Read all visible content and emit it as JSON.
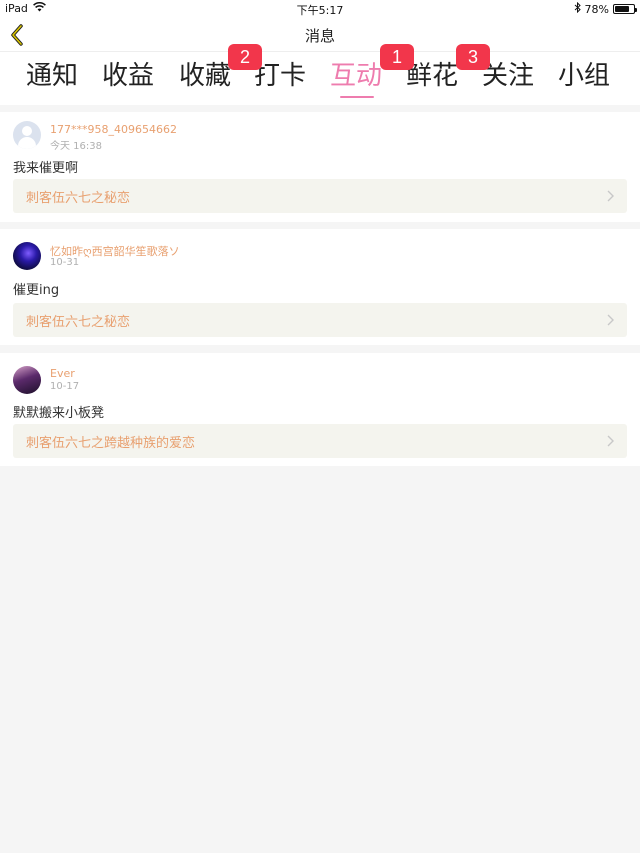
{
  "status_bar": {
    "device": "iPad",
    "time": "下午5:17",
    "battery": "78%",
    "battery_level": 0.78
  },
  "nav": {
    "title": "消息",
    "back_icon": "chevron-left-icon",
    "back_color": "#c9b800"
  },
  "tabs": [
    {
      "label": "通知"
    },
    {
      "label": "收益"
    },
    {
      "label": "收藏",
      "badge": "2"
    },
    {
      "label": "打卡"
    },
    {
      "label": "互动",
      "active": true,
      "badge": "1"
    },
    {
      "label": "鲜花",
      "badge": "3"
    },
    {
      "label": "关注"
    },
    {
      "label": "小组"
    }
  ],
  "colors": {
    "accent": "#ee7cae",
    "badge": "#f2364b",
    "username": "#e8a070",
    "link_bg": "#f4f4ee"
  },
  "messages": [
    {
      "username": "177***958_409654662",
      "time": "今天 16:38",
      "content": "我来催更啊",
      "link": "刺客伍六七之秘恋"
    },
    {
      "username": "忆如昨ღ西宫韶华笙歌落ソ",
      "time": "10-31",
      "content": "催更ing",
      "link": "刺客伍六七之秘恋"
    },
    {
      "username": "Ever",
      "time": "10-17",
      "content": "默默搬来小板凳",
      "link": "刺客伍六七之跨越种族的爱恋"
    }
  ]
}
